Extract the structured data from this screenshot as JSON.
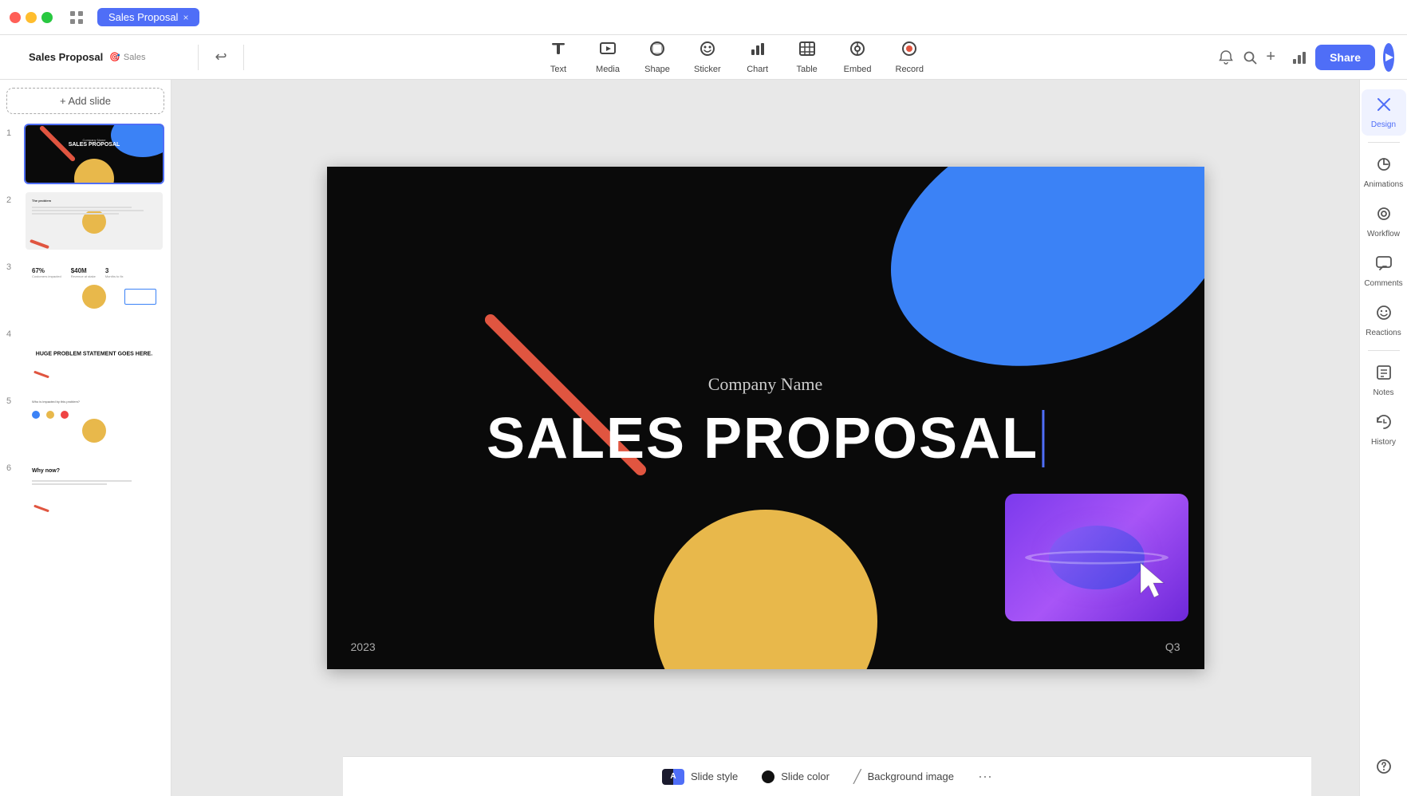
{
  "titlebar": {
    "tab_label": "Sales Proposal",
    "close_label": "×"
  },
  "toolbar": {
    "undo_icon": "↩",
    "tools": [
      {
        "id": "text",
        "label": "Text",
        "icon": "T"
      },
      {
        "id": "media",
        "label": "Media",
        "icon": "▦"
      },
      {
        "id": "shape",
        "label": "Shape",
        "icon": "⬡"
      },
      {
        "id": "sticker",
        "label": "Sticker",
        "icon": "🙂"
      },
      {
        "id": "chart",
        "label": "Chart",
        "icon": "📊"
      },
      {
        "id": "table",
        "label": "Table",
        "icon": "⊞"
      },
      {
        "id": "embed",
        "label": "Embed",
        "icon": "◎"
      },
      {
        "id": "record",
        "label": "Record",
        "icon": "⊙"
      }
    ],
    "share_label": "Share",
    "play_icon": "▶"
  },
  "sidebar": {
    "add_slide_label": "+ Add slide",
    "slides": [
      {
        "number": 1,
        "active": true
      },
      {
        "number": 2,
        "active": false
      },
      {
        "number": 3,
        "active": false
      },
      {
        "number": 4,
        "active": false
      },
      {
        "number": 5,
        "active": false
      },
      {
        "number": 6,
        "active": false
      }
    ]
  },
  "canvas": {
    "company_name": "Company Name",
    "title": "SALES PROPOSAL",
    "year": "2023",
    "quarter": "Q3"
  },
  "right_panel": {
    "items": [
      {
        "id": "design",
        "label": "Design",
        "icon": "✂",
        "active": true
      },
      {
        "id": "animations",
        "label": "Animations",
        "icon": "◈"
      },
      {
        "id": "workflow",
        "label": "Workflow",
        "icon": "⊕"
      },
      {
        "id": "comments",
        "label": "Comments",
        "icon": "💬"
      },
      {
        "id": "reactions",
        "label": "Reactions",
        "icon": "😊"
      },
      {
        "id": "notes",
        "label": "Notes",
        "icon": "⊘"
      },
      {
        "id": "history",
        "label": "History",
        "icon": "🕐"
      }
    ]
  },
  "bottom_bar": {
    "slide_style_label": "Slide style",
    "slide_color_label": "Slide color",
    "bg_image_label": "Background image",
    "more_label": "···",
    "slide_color_value": "#111111"
  }
}
